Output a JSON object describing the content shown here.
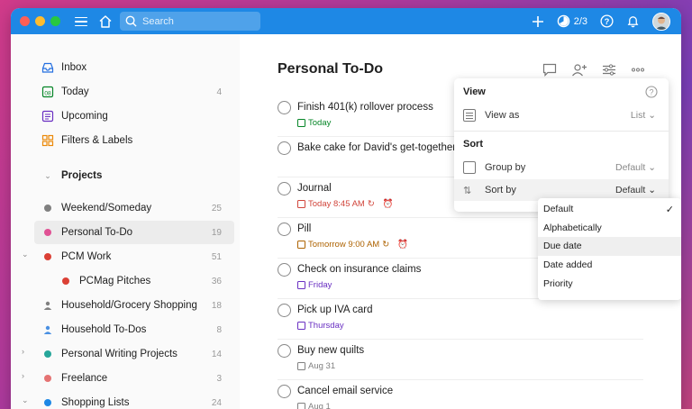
{
  "topbar": {
    "search_placeholder": "Search",
    "karma": "2/3",
    "colors": {
      "bar": "#1e88e5"
    }
  },
  "sidebar": {
    "nav": [
      {
        "label": "Inbox",
        "count": "",
        "icon": "inbox-icon"
      },
      {
        "label": "Today",
        "count": "4",
        "icon": "today-calendar-icon"
      },
      {
        "label": "Upcoming",
        "count": "",
        "icon": "upcoming-calendar-icon"
      },
      {
        "label": "Filters & Labels",
        "count": "",
        "icon": "filters-grid-icon"
      }
    ],
    "projects_title": "Projects",
    "projects": [
      {
        "label": "Weekend/Someday",
        "count": "25",
        "color": "#808080"
      },
      {
        "label": "Personal To-Do",
        "count": "19",
        "color": "#e05194"
      },
      {
        "label": "PCM Work",
        "count": "51",
        "color": "#db4035"
      },
      {
        "label": "PCMag Pitches",
        "count": "36",
        "color": "#db4035"
      },
      {
        "label": "Household/Grocery Shopping",
        "count": "18",
        "color": "#808080"
      },
      {
        "label": "Household To-Dos",
        "count": "8",
        "color": "#4a90e2"
      },
      {
        "label": "Personal Writing Projects",
        "count": "14",
        "color": "#26a69a"
      },
      {
        "label": "Freelance",
        "count": "3",
        "color": "#e57373"
      },
      {
        "label": "Shopping Lists",
        "count": "24",
        "color": "#1e88e5"
      }
    ]
  },
  "main": {
    "title": "Personal To-Do",
    "tasks": [
      {
        "name": "Finish 401(k) rollover process",
        "due": "Today",
        "color": "#058527",
        "recurring": false,
        "alarm": false
      },
      {
        "name": "Bake cake for David's get-together",
        "due": "",
        "color": "",
        "recurring": false,
        "alarm": false
      },
      {
        "name": "Journal",
        "due": "Today 8:45 AM",
        "color": "#d1453b",
        "recurring": true,
        "alarm": true
      },
      {
        "name": "Pill",
        "due": "Tomorrow 9:00 AM",
        "color": "#ad6200",
        "recurring": true,
        "alarm": true
      },
      {
        "name": "Check on insurance claims",
        "due": "Friday",
        "color": "#692fc2",
        "recurring": false,
        "alarm": false
      },
      {
        "name": "Pick up IVA card",
        "due": "Thursday",
        "color": "#692fc2",
        "recurring": false,
        "alarm": false
      },
      {
        "name": "Buy new quilts",
        "due": "Aug 31",
        "color": "#808080",
        "recurring": false,
        "alarm": false
      },
      {
        "name": "Cancel email service",
        "due": "Aug 1",
        "color": "#808080",
        "recurring": false,
        "alarm": false
      }
    ]
  },
  "view_panel": {
    "view_title": "View",
    "view_as_label": "View as",
    "view_as_value": "List",
    "sort_title": "Sort",
    "group_by_label": "Group by",
    "group_by_value": "Default",
    "sort_by_label": "Sort by",
    "sort_by_value": "Default"
  },
  "sort_dropdown": {
    "options": [
      "Default",
      "Alphabetically",
      "Due date",
      "Date added",
      "Priority"
    ],
    "selected": "Default",
    "highlighted": "Due date"
  }
}
